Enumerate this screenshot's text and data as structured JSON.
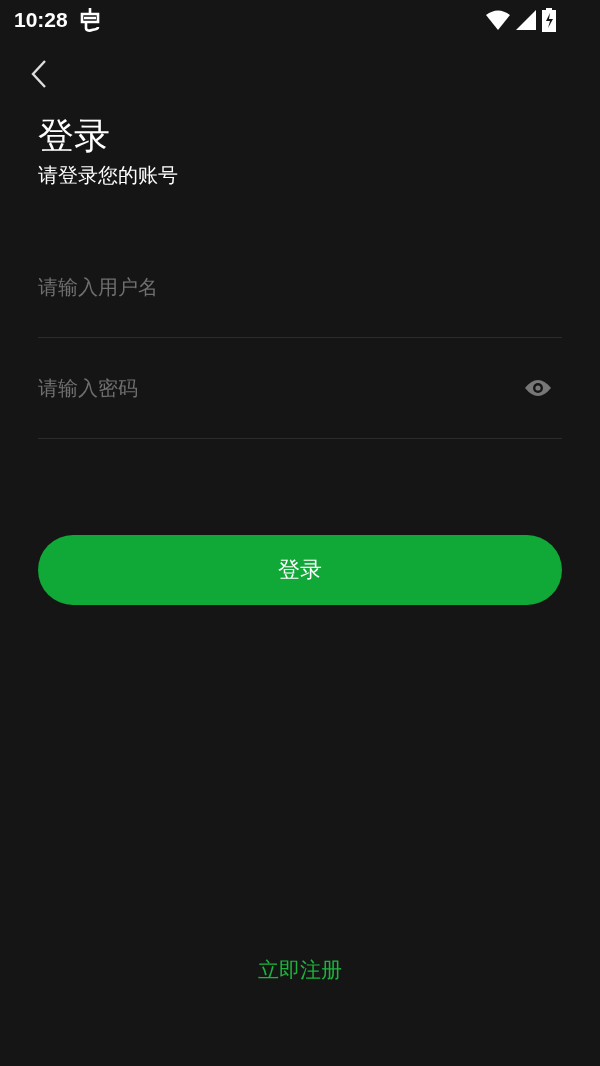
{
  "status_bar": {
    "time": "10:28"
  },
  "header": {
    "title": "登录",
    "subtitle": "请登录您的账号"
  },
  "fields": [
    {
      "kind": "text",
      "placeholder": "请输入用户名"
    },
    {
      "kind": "password",
      "placeholder": "请输入密码"
    }
  ],
  "login_button": "登录",
  "register_link": "立即注册"
}
